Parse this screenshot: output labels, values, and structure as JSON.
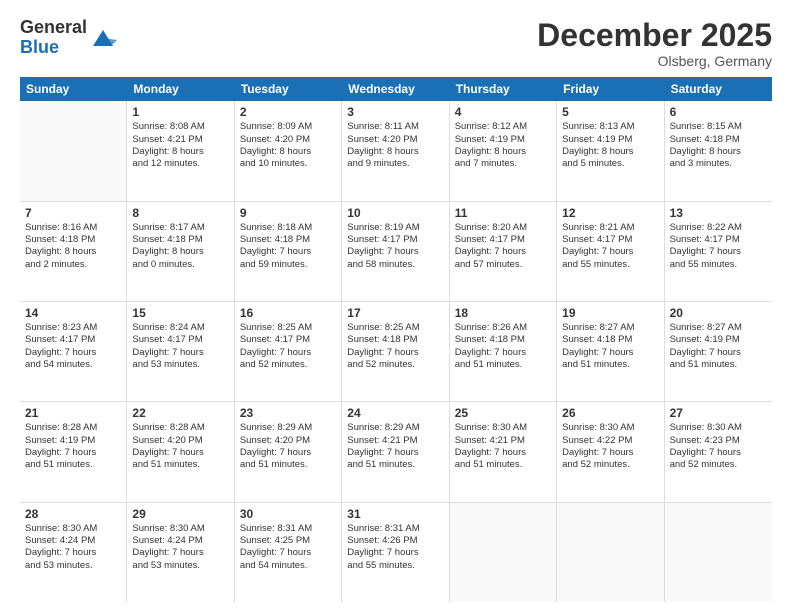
{
  "logo": {
    "general": "General",
    "blue": "Blue"
  },
  "title": "December 2025",
  "location": "Olsberg, Germany",
  "days": [
    "Sunday",
    "Monday",
    "Tuesday",
    "Wednesday",
    "Thursday",
    "Friday",
    "Saturday"
  ],
  "weeks": [
    [
      {
        "empty": true
      },
      {
        "num": "1",
        "l1": "Sunrise: 8:08 AM",
        "l2": "Sunset: 4:21 PM",
        "l3": "Daylight: 8 hours",
        "l4": "and 12 minutes."
      },
      {
        "num": "2",
        "l1": "Sunrise: 8:09 AM",
        "l2": "Sunset: 4:20 PM",
        "l3": "Daylight: 8 hours",
        "l4": "and 10 minutes."
      },
      {
        "num": "3",
        "l1": "Sunrise: 8:11 AM",
        "l2": "Sunset: 4:20 PM",
        "l3": "Daylight: 8 hours",
        "l4": "and 9 minutes."
      },
      {
        "num": "4",
        "l1": "Sunrise: 8:12 AM",
        "l2": "Sunset: 4:19 PM",
        "l3": "Daylight: 8 hours",
        "l4": "and 7 minutes."
      },
      {
        "num": "5",
        "l1": "Sunrise: 8:13 AM",
        "l2": "Sunset: 4:19 PM",
        "l3": "Daylight: 8 hours",
        "l4": "and 5 minutes."
      },
      {
        "num": "6",
        "l1": "Sunrise: 8:15 AM",
        "l2": "Sunset: 4:18 PM",
        "l3": "Daylight: 8 hours",
        "l4": "and 3 minutes."
      }
    ],
    [
      {
        "num": "7",
        "l1": "Sunrise: 8:16 AM",
        "l2": "Sunset: 4:18 PM",
        "l3": "Daylight: 8 hours",
        "l4": "and 2 minutes."
      },
      {
        "num": "8",
        "l1": "Sunrise: 8:17 AM",
        "l2": "Sunset: 4:18 PM",
        "l3": "Daylight: 8 hours",
        "l4": "and 0 minutes."
      },
      {
        "num": "9",
        "l1": "Sunrise: 8:18 AM",
        "l2": "Sunset: 4:18 PM",
        "l3": "Daylight: 7 hours",
        "l4": "and 59 minutes."
      },
      {
        "num": "10",
        "l1": "Sunrise: 8:19 AM",
        "l2": "Sunset: 4:17 PM",
        "l3": "Daylight: 7 hours",
        "l4": "and 58 minutes."
      },
      {
        "num": "11",
        "l1": "Sunrise: 8:20 AM",
        "l2": "Sunset: 4:17 PM",
        "l3": "Daylight: 7 hours",
        "l4": "and 57 minutes."
      },
      {
        "num": "12",
        "l1": "Sunrise: 8:21 AM",
        "l2": "Sunset: 4:17 PM",
        "l3": "Daylight: 7 hours",
        "l4": "and 55 minutes."
      },
      {
        "num": "13",
        "l1": "Sunrise: 8:22 AM",
        "l2": "Sunset: 4:17 PM",
        "l3": "Daylight: 7 hours",
        "l4": "and 55 minutes."
      }
    ],
    [
      {
        "num": "14",
        "l1": "Sunrise: 8:23 AM",
        "l2": "Sunset: 4:17 PM",
        "l3": "Daylight: 7 hours",
        "l4": "and 54 minutes."
      },
      {
        "num": "15",
        "l1": "Sunrise: 8:24 AM",
        "l2": "Sunset: 4:17 PM",
        "l3": "Daylight: 7 hours",
        "l4": "and 53 minutes."
      },
      {
        "num": "16",
        "l1": "Sunrise: 8:25 AM",
        "l2": "Sunset: 4:17 PM",
        "l3": "Daylight: 7 hours",
        "l4": "and 52 minutes."
      },
      {
        "num": "17",
        "l1": "Sunrise: 8:25 AM",
        "l2": "Sunset: 4:18 PM",
        "l3": "Daylight: 7 hours",
        "l4": "and 52 minutes."
      },
      {
        "num": "18",
        "l1": "Sunrise: 8:26 AM",
        "l2": "Sunset: 4:18 PM",
        "l3": "Daylight: 7 hours",
        "l4": "and 51 minutes."
      },
      {
        "num": "19",
        "l1": "Sunrise: 8:27 AM",
        "l2": "Sunset: 4:18 PM",
        "l3": "Daylight: 7 hours",
        "l4": "and 51 minutes."
      },
      {
        "num": "20",
        "l1": "Sunrise: 8:27 AM",
        "l2": "Sunset: 4:19 PM",
        "l3": "Daylight: 7 hours",
        "l4": "and 51 minutes."
      }
    ],
    [
      {
        "num": "21",
        "l1": "Sunrise: 8:28 AM",
        "l2": "Sunset: 4:19 PM",
        "l3": "Daylight: 7 hours",
        "l4": "and 51 minutes."
      },
      {
        "num": "22",
        "l1": "Sunrise: 8:28 AM",
        "l2": "Sunset: 4:20 PM",
        "l3": "Daylight: 7 hours",
        "l4": "and 51 minutes."
      },
      {
        "num": "23",
        "l1": "Sunrise: 8:29 AM",
        "l2": "Sunset: 4:20 PM",
        "l3": "Daylight: 7 hours",
        "l4": "and 51 minutes."
      },
      {
        "num": "24",
        "l1": "Sunrise: 8:29 AM",
        "l2": "Sunset: 4:21 PM",
        "l3": "Daylight: 7 hours",
        "l4": "and 51 minutes."
      },
      {
        "num": "25",
        "l1": "Sunrise: 8:30 AM",
        "l2": "Sunset: 4:21 PM",
        "l3": "Daylight: 7 hours",
        "l4": "and 51 minutes."
      },
      {
        "num": "26",
        "l1": "Sunrise: 8:30 AM",
        "l2": "Sunset: 4:22 PM",
        "l3": "Daylight: 7 hours",
        "l4": "and 52 minutes."
      },
      {
        "num": "27",
        "l1": "Sunrise: 8:30 AM",
        "l2": "Sunset: 4:23 PM",
        "l3": "Daylight: 7 hours",
        "l4": "and 52 minutes."
      }
    ],
    [
      {
        "num": "28",
        "l1": "Sunrise: 8:30 AM",
        "l2": "Sunset: 4:24 PM",
        "l3": "Daylight: 7 hours",
        "l4": "and 53 minutes."
      },
      {
        "num": "29",
        "l1": "Sunrise: 8:30 AM",
        "l2": "Sunset: 4:24 PM",
        "l3": "Daylight: 7 hours",
        "l4": "and 53 minutes."
      },
      {
        "num": "30",
        "l1": "Sunrise: 8:31 AM",
        "l2": "Sunset: 4:25 PM",
        "l3": "Daylight: 7 hours",
        "l4": "and 54 minutes."
      },
      {
        "num": "31",
        "l1": "Sunrise: 8:31 AM",
        "l2": "Sunset: 4:26 PM",
        "l3": "Daylight: 7 hours",
        "l4": "and 55 minutes."
      },
      {
        "empty": true
      },
      {
        "empty": true
      },
      {
        "empty": true
      }
    ]
  ]
}
